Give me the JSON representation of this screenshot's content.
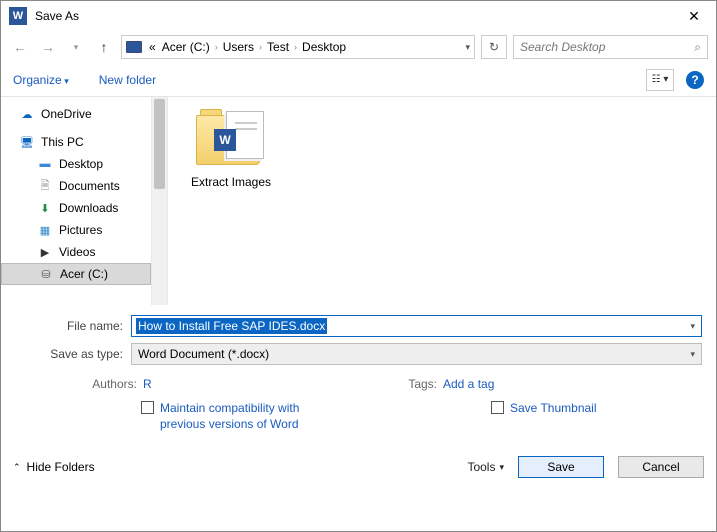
{
  "window": {
    "title": "Save As"
  },
  "nav": {
    "crumbs_prefix": "«",
    "crumbs": [
      "Acer (C:)",
      "Users",
      "Test",
      "Desktop"
    ],
    "search_placeholder": "Search Desktop"
  },
  "toolbar": {
    "organize": "Organize",
    "new_folder": "New folder"
  },
  "tree": {
    "onedrive": "OneDrive",
    "thispc": "This PC",
    "desktop": "Desktop",
    "documents": "Documents",
    "downloads": "Downloads",
    "pictures": "Pictures",
    "videos": "Videos",
    "acerc": "Acer (C:)"
  },
  "content": {
    "folder1": "Extract Images"
  },
  "form": {
    "filename_label": "File name:",
    "filename_value": "How to Install Free SAP IDES.docx",
    "type_label": "Save as type:",
    "type_value": "Word Document (*.docx)"
  },
  "meta": {
    "authors_label": "Authors:",
    "authors_value": "R",
    "tags_label": "Tags:",
    "tags_value": "Add a tag"
  },
  "checks": {
    "compat": "Maintain compatibility with previous versions of Word",
    "thumb": "Save Thumbnail"
  },
  "footer": {
    "hide_folders": "Hide Folders",
    "tools": "Tools",
    "save": "Save",
    "cancel": "Cancel"
  }
}
